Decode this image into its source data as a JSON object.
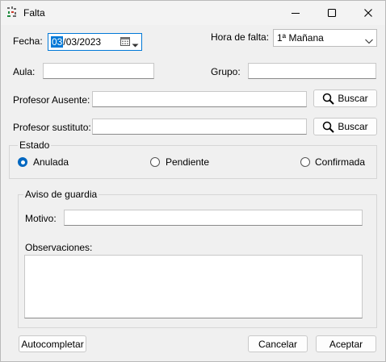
{
  "window": {
    "title": "Falta"
  },
  "form": {
    "fecha_label": "Fecha:",
    "fecha_value_sel": "03",
    "fecha_value_rest": "/03/2023",
    "hora_label": "Hora de falta:",
    "hora_value": "1ª Mañana",
    "aula_label": "Aula:",
    "aula_value": "",
    "grupo_label": "Grupo:",
    "grupo_value": "",
    "prof_ausente_label": "Profesor Ausente:",
    "prof_ausente_value": "",
    "prof_sustituto_label": "Profesor sustituto:",
    "prof_sustituto_value": "",
    "buscar_label": "Buscar"
  },
  "estado": {
    "title": "Estado",
    "options": [
      {
        "label": "Anulada",
        "selected": true
      },
      {
        "label": "Pendiente",
        "selected": false
      },
      {
        "label": "Confirmada",
        "selected": false
      }
    ]
  },
  "aviso": {
    "title": "Aviso de guardia",
    "motivo_label": "Motivo:",
    "motivo_value": "",
    "observaciones_label": "Observaciones:",
    "observaciones_value": ""
  },
  "buttons": {
    "autocompletar": "Autocompletar",
    "cancelar": "Cancelar",
    "aceptar": "Aceptar"
  },
  "colors": {
    "accent": "#0067c0",
    "selection": "#0078d7"
  },
  "icons": [
    "app-icon",
    "minimize-icon",
    "maximize-icon",
    "close-icon",
    "calendar-icon",
    "chevron-down-icon",
    "search-icon"
  ]
}
